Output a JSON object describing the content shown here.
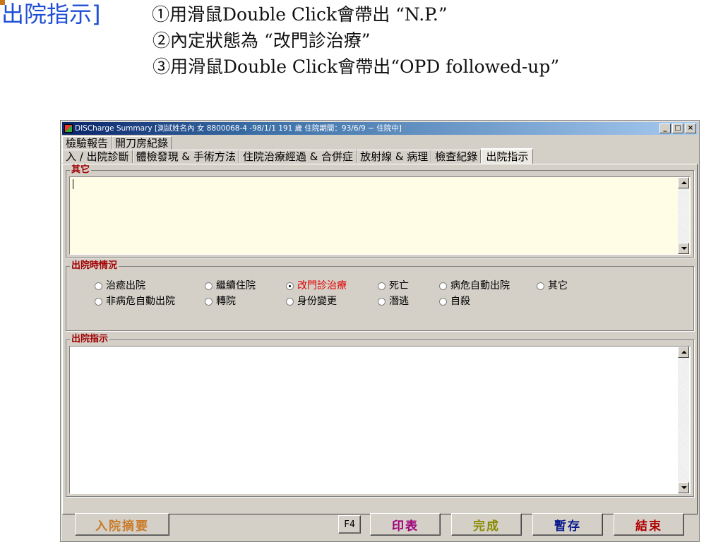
{
  "slide": {
    "title": "出院指示]",
    "notes": [
      "①用滑鼠Double Click會帶出 “N.P.”",
      "②內定狀態為 “改門診治療”",
      "③用滑鼠Double Click會帶出“OPD followed-up”"
    ]
  },
  "window": {
    "title": "DISCharge Summary [測試姓名內  女  8800068-4  -98/1/1  191 歲  住院期間：93/6/9 ~ 住院中]",
    "controls": {
      "minimize": "_",
      "maximize": "□",
      "close": "×"
    }
  },
  "tabs_row1": [
    "檢驗報告",
    "開刀房紀錄"
  ],
  "tabs_row2": [
    "入 / 出院診斷",
    "體檢發現 & 手術方法",
    "住院治療經過 & 合併症",
    "放射線 & 病理",
    "檢查紀錄",
    "出院指示"
  ],
  "active_tab": "出院指示",
  "groups": {
    "other": {
      "label": "其它",
      "value": ""
    },
    "status": {
      "label": "出院時情況",
      "options": [
        "治癒出院",
        "繼續住院",
        "改門診治療",
        "死亡",
        "病危自動出院",
        "其它",
        "非病危自動出院",
        "轉院",
        "身份變更",
        "潛逃",
        "自殺"
      ],
      "selected": "改門診治療"
    },
    "instructions": {
      "label": "出院指示",
      "value": ""
    }
  },
  "buttons": {
    "admission_summary": "入院摘要",
    "f4": "F4",
    "print": "印表",
    "complete": "完成",
    "save_draft": "暫存",
    "exit": "結束"
  },
  "colors": {
    "title_blue": "#1f4fd6",
    "group_label": "#a00000",
    "selected_radio": "#e00000",
    "other_textarea_bg": "#fffde6"
  }
}
